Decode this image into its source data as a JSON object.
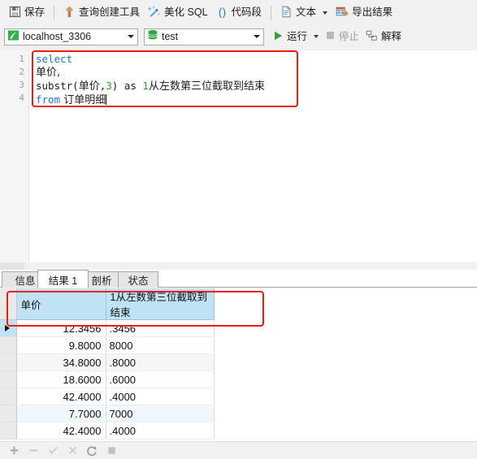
{
  "toolbar": {
    "items": [
      {
        "label": "保存",
        "icon": "save-icon"
      },
      {
        "label": "查询创建工具",
        "icon": "query-builder-icon"
      },
      {
        "label": "美化 SQL",
        "icon": "beautify-sql-icon"
      },
      {
        "label": "代码段",
        "icon": "code-snippet-icon"
      },
      {
        "label": "文本",
        "icon": "text-icon"
      },
      {
        "label": "导出结果",
        "icon": "export-result-icon"
      }
    ]
  },
  "toolbar2": {
    "connection": {
      "value": "localhost_3306",
      "icon": "connection-icon"
    },
    "database": {
      "value": "test",
      "icon": "database-icon"
    },
    "run_label": "运行",
    "stop_label": "停止",
    "explain_label": "解释"
  },
  "editor": {
    "line_numbers": [
      "1",
      "2",
      "3",
      "4"
    ],
    "lines": [
      {
        "kw": "select",
        "rest": ""
      },
      {
        "kw": "",
        "rest": "单价,"
      },
      {
        "kw": "",
        "rest": "substr(单价,3) as 1从左数第三位截取到结束"
      },
      {
        "kw": "from",
        "rest": " 订单明细"
      }
    ],
    "sql_text": "select\n单价,\nsubstr(单价,3) as 1从左数第三位截取到结束\nfrom 订单明细",
    "tokens": {
      "select": "select",
      "col1": "单价,",
      "substr_a": "substr(",
      "substr_col": "单价",
      "comma": ",",
      "three": "3",
      "paren": ")",
      "as": " as ",
      "alias_num": "1",
      "alias_text": "从左数第三位截取到结束",
      "from": "from",
      "table": " 订单明细"
    }
  },
  "result_tabs": [
    {
      "label": "信息",
      "active": false
    },
    {
      "label": "结果 1",
      "active": true
    },
    {
      "label": "剖析",
      "active": false
    },
    {
      "label": "状态",
      "active": false
    }
  ],
  "grid": {
    "columns": [
      "单价",
      "1从左数第三位截取到结束"
    ],
    "rows": [
      {
        "单价": "12.3456",
        "alias": ".3456",
        "selected": true,
        "stripe": "none"
      },
      {
        "单价": "9.8000",
        "alias": "8000",
        "selected": false,
        "stripe": "none"
      },
      {
        "单价": "34.8000",
        "alias": ".8000",
        "selected": false,
        "stripe": "gray"
      },
      {
        "单价": "18.6000",
        "alias": ".6000",
        "selected": false,
        "stripe": "none"
      },
      {
        "单价": "42.4000",
        "alias": ".4000",
        "selected": false,
        "stripe": "none"
      },
      {
        "单价": "7.7000",
        "alias": "7000",
        "selected": false,
        "stripe": "blue"
      },
      {
        "单价": "42.4000",
        "alias": ".4000",
        "selected": false,
        "stripe": "none"
      }
    ]
  },
  "bottombar": {
    "buttons": [
      {
        "name": "add-record-button",
        "glyph": "+"
      },
      {
        "name": "delete-record-button",
        "glyph": "−"
      },
      {
        "name": "apply-change-button",
        "glyph": "✓"
      },
      {
        "name": "cancel-change-button",
        "glyph": "✕"
      },
      {
        "name": "refresh-button",
        "glyph": "⟳"
      },
      {
        "name": "stop-loading-button",
        "glyph": "■"
      }
    ]
  },
  "colors": {
    "accent_red": "#ee1c11",
    "toolbar_bg": "#f1f1f1",
    "header_blue": "#bfe3f5",
    "keyword_blue": "#1f75cc",
    "number_green": "#2aa12a",
    "run_green": "#3aa033"
  }
}
